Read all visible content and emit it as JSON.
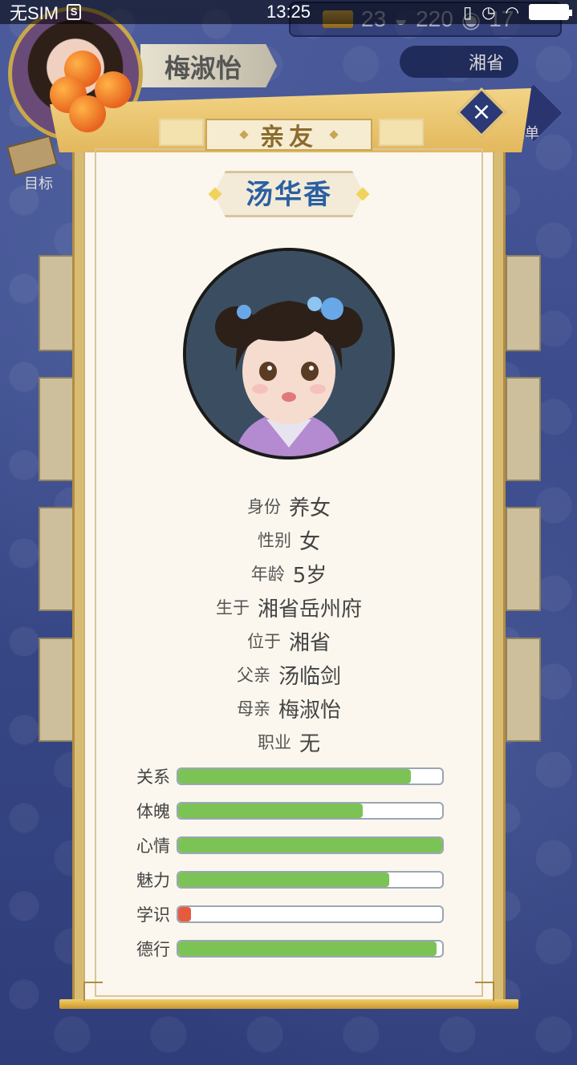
{
  "status_bar": {
    "carrier": "无SIM",
    "sim_icon": "S",
    "time": "13:25",
    "icons": [
      "vibrate-icon",
      "alarm-icon",
      "wifi-icon",
      "battery-icon"
    ]
  },
  "header": {
    "currency_gold": "23",
    "currency_silver": "220",
    "currency_coin": "17",
    "player_name": "梅淑怡",
    "location": "湘省",
    "goal_label": "目标",
    "menu_label": "菜单"
  },
  "modal": {
    "title": "亲友",
    "close_icon": "×",
    "person_name": "汤华香",
    "info": [
      {
        "key": "身份",
        "value": "养女"
      },
      {
        "key": "性别",
        "value": "女"
      },
      {
        "key": "年龄",
        "value": "5岁"
      },
      {
        "key": "生于",
        "value": "湘省岳州府"
      },
      {
        "key": "位于",
        "value": "湘省"
      },
      {
        "key": "父亲",
        "value": "汤临剑"
      },
      {
        "key": "母亲",
        "value": "梅淑怡"
      },
      {
        "key": "职业",
        "value": "无"
      }
    ],
    "stats": [
      {
        "label": "关系",
        "value": 0.88,
        "color": "#7cc356"
      },
      {
        "label": "体魄",
        "value": 0.7,
        "color": "#7cc356"
      },
      {
        "label": "心情",
        "value": 1.0,
        "color": "#7cc356"
      },
      {
        "label": "魅力",
        "value": 0.8,
        "color": "#7cc356"
      },
      {
        "label": "学识",
        "value": 0.05,
        "color": "#e85a3d"
      },
      {
        "label": "德行",
        "value": 0.98,
        "color": "#7cc356"
      }
    ]
  }
}
